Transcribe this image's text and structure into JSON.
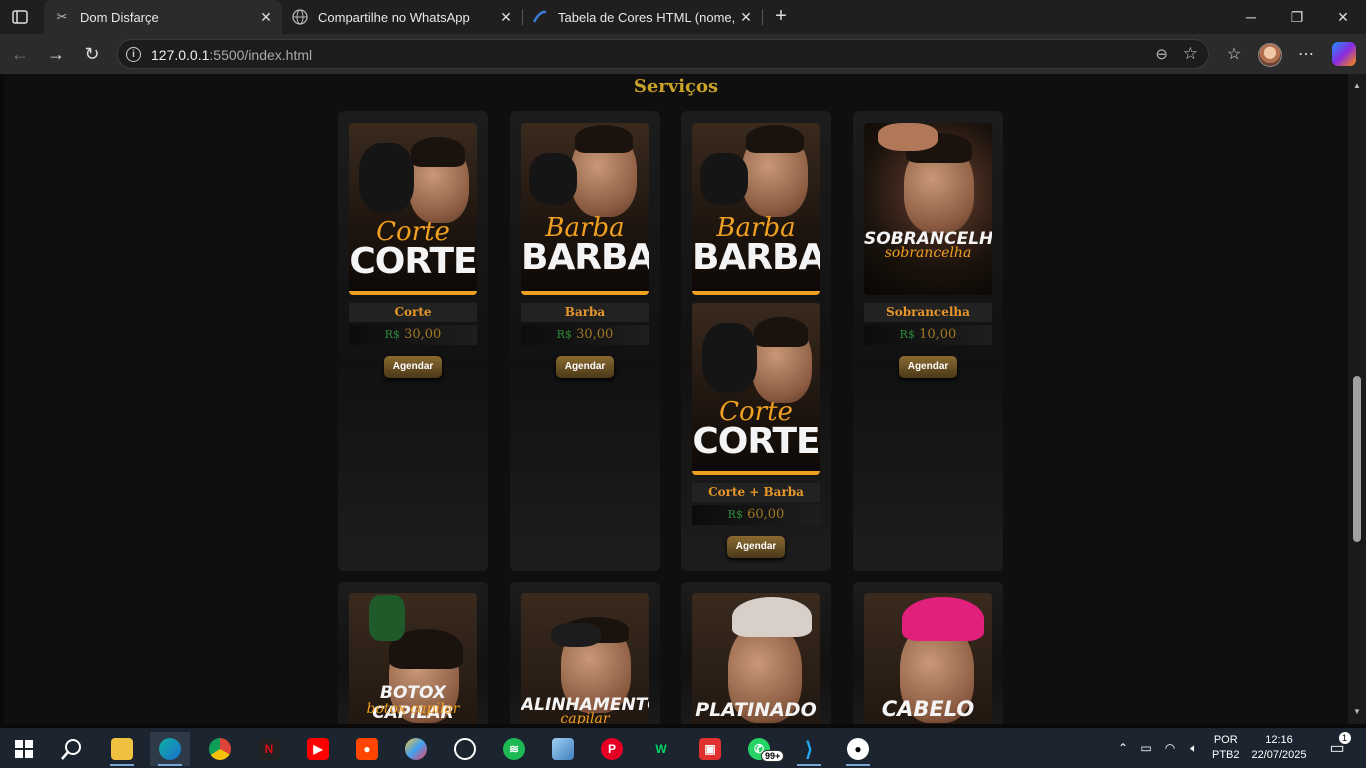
{
  "browser": {
    "tabs": [
      {
        "title": "Dom Disfarçe",
        "active": true
      },
      {
        "title": "Compartilhe no WhatsApp",
        "active": false
      },
      {
        "title": "Tabela de Cores HTML (nome, hex",
        "active": false
      }
    ],
    "url_host": "127.0.0.1",
    "url_rest": ":5500/index.html"
  },
  "page": {
    "section_title": "Serviços",
    "agendar_label": "Agendar",
    "services": [
      {
        "name": "Corte",
        "currency": "R$",
        "price": "30,00",
        "overlay_script": "Corte",
        "overlay_big": "CORTE"
      },
      {
        "name": "Barba",
        "currency": "R$",
        "price": "30,00",
        "overlay_script": "Barba",
        "overlay_big": "BARBA"
      },
      {
        "name": "Corte + Barba",
        "currency": "R$",
        "price": "60,00",
        "overlay_script": "Barba",
        "overlay_big": "BARBA",
        "overlay_script_2": "Corte",
        "overlay_big_2": "CORTE"
      },
      {
        "name": "Sobrancelha",
        "currency": "R$",
        "price": "10,00",
        "overlay_italic": "SOBRANCELHA",
        "overlay_sub": "sobrancelha"
      }
    ],
    "services_row2": [
      {
        "overlay_italic": "BOTOX CAPILAR",
        "overlay_sub": "botox capilar"
      },
      {
        "overlay_italic": "ALINHAMENTO",
        "overlay_sub": "capilar"
      },
      {
        "overlay_italic": "PLATINADO",
        "overlay_sub": ""
      },
      {
        "overlay_italic": "CABELO",
        "overlay_sub": ""
      }
    ]
  },
  "taskbar": {
    "whatsapp_badge": "99+",
    "lang": "POR",
    "layout": "PTB2",
    "time": "12:16",
    "date": "22/07/2025",
    "notifications": "1"
  },
  "colors": {
    "accent_gold": "#c9a227",
    "name_orange": "#e8962a",
    "price_green": "#2e8b3a"
  }
}
